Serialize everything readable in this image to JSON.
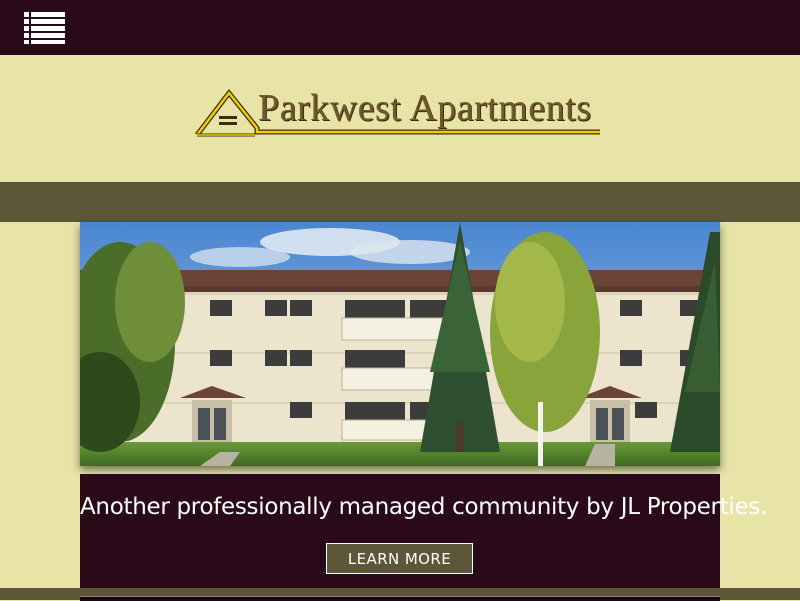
{
  "header": {
    "menu_icon": "list-menu-icon",
    "background": "#2a0a18"
  },
  "logo": {
    "text": "Parkwest Apartments",
    "icon": "house-roof-icon",
    "accent": "#f0d000"
  },
  "hero": {
    "image": "apartment-building-photo"
  },
  "banner": {
    "text": "Another professionally managed community by JL Properties.",
    "button_label": "LEARN MORE"
  },
  "colors": {
    "page_bg": "#e8e4a8",
    "band": "#5e5638",
    "dark": "#2a0a18"
  }
}
